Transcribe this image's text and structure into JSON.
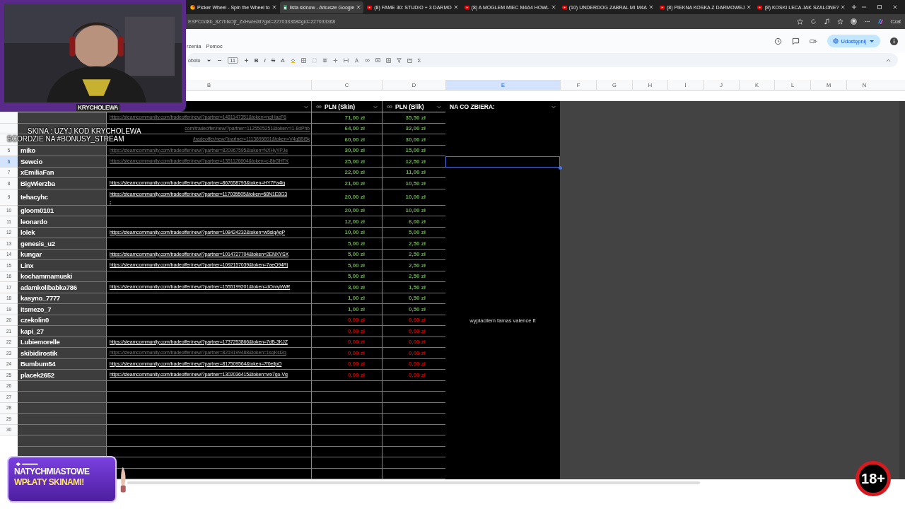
{
  "browser": {
    "tabs": [
      {
        "title": "Picker Wheel - Spin the Wheel to",
        "selected": false
      },
      {
        "title": "lista skinow - Arkusze Google",
        "selected": true
      },
      {
        "title": "(8) FAME 30: STUDIO + 3 DARMO",
        "selected": false
      },
      {
        "title": "(8) A MOGLEM MIEC M4A4 HOWL",
        "selected": false
      },
      {
        "title": "(10) UNDERDOG ZABRAL MI M4A",
        "selected": false
      },
      {
        "title": "(8) PIEKNA KOSKA Z DARMOWEJ",
        "selected": false
      },
      {
        "title": "(8) KOSKI LECA JAK SZALONE?",
        "selected": false
      }
    ],
    "address": "ESPC0d8b_8Z7hlkOjf_ZxHw/edit?gid=227033368#gid=227033368",
    "chat": "Czat"
  },
  "sheets": {
    "menu": [
      "rzenia",
      "Pomoc"
    ],
    "share_button": "Udostępnij",
    "toolbar": {
      "font": "oboto",
      "size": "11",
      "format_buttons": [
        "B",
        "I",
        "S",
        "A"
      ],
      "sum": "Σ"
    }
  },
  "column_letters": [
    {
      "label": "B",
      "selected": false
    },
    {
      "label": "C",
      "selected": false
    },
    {
      "label": "D",
      "selected": false
    },
    {
      "label": "E",
      "selected": true
    },
    {
      "label": "F",
      "selected": false
    },
    {
      "label": "G",
      "selected": false
    },
    {
      "label": "H",
      "selected": false
    },
    {
      "label": "I",
      "selected": false
    },
    {
      "label": "J",
      "selected": false
    },
    {
      "label": "K",
      "selected": false
    },
    {
      "label": "L",
      "selected": false
    },
    {
      "label": "M",
      "selected": false
    },
    {
      "label": "N",
      "selected": false
    }
  ],
  "header_row": {
    "column_c": "PLN (Skin)",
    "column_d": "PLN (Blik)",
    "column_e": "NA CO ZBIERA:"
  },
  "rows": [
    {
      "link": "https://steamcommunity.com/tradeoffer/new/?partner=1481147351&token=ncjHacF6",
      "link_dim": true,
      "skin": "71,00 zł",
      "blik": "35,50 zł",
      "color": "#6aa84f",
      "selected": false
    },
    {
      "link": "com/tradeoffer/new/?partner=1125505251&token=I1-8dPhb",
      "link_dim": true,
      "covered": true,
      "skin": "64,00 zł",
      "blik": "32,00 zł",
      "color": "#6aa84f",
      "selected": false
    },
    {
      "link": "/tradeoffer/new/?partner=1113895891&token=V4q8Bi5k",
      "link_dim": true,
      "covered": true,
      "skin": "60,00 zł",
      "blik": "30,00 zł",
      "color": "#6aa84f",
      "selected": false
    },
    {
      "number": "5",
      "name": "miko",
      "link": "https://steamcommunity.com/tradeoffer/new/?partner=820967595&token=NXHyYPJe",
      "link_dim": true,
      "skin": "30,00 zł",
      "blik": "15,00 zł",
      "color": "#6aa84f",
      "selected": false
    },
    {
      "number": "6",
      "name": "Sewcio",
      "link": "https://steamcommunity.com/tradeoffer/new/?partner=1351126604&token=c-8bGHTK",
      "link_dim": true,
      "skin": "25,00 zł",
      "blik": "12,50 zł",
      "color": "#6aa84f",
      "selected": true
    },
    {
      "number": "7",
      "name": "xEmiliaFan",
      "skin": "22,00 zł",
      "blik": "11,00 zł",
      "color": "#6aa84f",
      "selected": false
    },
    {
      "number": "8",
      "name": "BigWierzba",
      "link": "https://steamcommunity.com/tradeoffer/new/?partner=867658793&token=HY7Fa4lg",
      "link_dim": false,
      "skin": "21,00 zł",
      "blik": "10,50 zł",
      "color": "#6aa84f",
      "selected": false
    },
    {
      "number": "9",
      "name": "tehacyhc",
      "link": "https://steamcommunity.com/tradeoffer/new/?partner=117035505&token=68N1E8G3\n-",
      "link_dim": false,
      "skin": "20,00 zł",
      "blik": "10,00 zł",
      "color": "#6aa84f",
      "selected": false
    },
    {
      "number": "10",
      "name": "gloom0101",
      "skin": "20,00 zł",
      "blik": "10,00 zł",
      "color": "#6aa84f",
      "selected": false
    },
    {
      "number": "11",
      "name": "leonardo",
      "skin": "12,00 zł",
      "blik": "6,00 zł",
      "color": "#6aa84f",
      "selected": false
    },
    {
      "number": "12",
      "name": "lolek",
      "link": "https://steamcommunity.com/tradeoffer/new/?partner=108424232&token=w5slqAgP",
      "link_dim": false,
      "skin": "10,00 zł",
      "blik": "5,00 zł",
      "color": "#6aa84f",
      "selected": false
    },
    {
      "number": "13",
      "name": "genesis_u2",
      "skin": "5,00 zł",
      "blik": "2,50 zł",
      "color": "#6aa84f",
      "selected": false
    },
    {
      "number": "14",
      "name": "kungar",
      "link": "https://steamcommunity.com/tradeoffer/new/?partner=1014727704&token=2ENXYSX",
      "link_dim": false,
      "skin": "5,00 zł",
      "blik": "2,50 zł",
      "color": "#6aa84f",
      "selected": false
    },
    {
      "number": "15",
      "name": "Linx",
      "link": "https://steamcommunity.com/tradeoffer/new/?partner=1092157039&token=7aeQ94Rj",
      "link_dim": false,
      "skin": "5,00 zł",
      "blik": "2,50 zł",
      "color": "#6aa84f",
      "selected": false
    },
    {
      "number": "16",
      "name": "kochammamuski",
      "skin": "5,00 zł",
      "blik": "2,50 zł",
      "color": "#6aa84f",
      "selected": false
    },
    {
      "number": "17",
      "name": "adamkolibabka786",
      "link": "https://steamcommunity.com/tradeoffer/new/?partner=1555199201&token=dOnryhWR",
      "link_dim": false,
      "skin": "3,00 zł",
      "blik": "1,50 zł",
      "color": "#6aa84f",
      "selected": false
    },
    {
      "number": "18",
      "name": "kasyno_7777",
      "skin": "1,00 zł",
      "blik": "0,50 zł",
      "color": "#6aa84f",
      "selected": false
    },
    {
      "number": "19",
      "name": "itsmezo_7",
      "skin": "1,00 zł",
      "blik": "0,50 zł",
      "color": "#6aa84f",
      "selected": false
    },
    {
      "number": "20",
      "name": "czekolin0",
      "skin": "0,00 zł",
      "blik": "0,00 zł",
      "color": "#cc0000",
      "note": "wyplacilem famas valence ft",
      "selected": false
    },
    {
      "number": "21",
      "name": "kapi_27",
      "skin": "0,00 zł",
      "blik": "0,00 zł",
      "color": "#cc0000",
      "selected": false
    },
    {
      "number": "22",
      "name": "Lubiemorelle",
      "link": "https://steamcommunity.com/tradeoffer/new/?partner=1737253866&token=7dB-3KJZ",
      "link_dim": false,
      "skin": "0,00 zł",
      "blik": "0,00 zł",
      "color": "#cc0000",
      "selected": false
    },
    {
      "number": "23",
      "name": "skibidirostik",
      "link": "https://steamcommunity.com/tradeoffer/new/?partner=8219199488&token=1sqKsI2g",
      "link_dim": true,
      "skin": "0,00 zł",
      "blik": "0,00 zł",
      "color": "#cc0000",
      "selected": false
    },
    {
      "number": "24",
      "name": "Bumbum54",
      "link": "https://steamcommunity.com/tradeoffer/new/?partner=817509564&token=7f0eIlpO",
      "link_dim": false,
      "skin": "0,00 zł",
      "blik": "0,00 zł",
      "color": "#cc0000",
      "selected": false
    },
    {
      "number": "25",
      "name": "placek2652",
      "link": "https://steamcommunity.com/tradeoffer/new/?partner=1302036415&token=wx7go-Vg",
      "link_dim": false,
      "skin": "0,00 zł",
      "blik": "0,00 zł",
      "color": "#cc0000",
      "selected": false
    }
  ],
  "empty_rows": [
    "26",
    "27",
    "28",
    "29",
    "30"
  ],
  "overlays": {
    "webcam_label": "KRYCHOLEWA",
    "ticker_lines": [
      "SKINA : UZYJ KOD KRYCHOLEWA",
      "SCORDZIE NA #BONUSY_STREAM"
    ],
    "promo_lines": [
      "NATYCHMIASTOWE",
      "WPŁATY SKINAMI!"
    ],
    "age_badge": "18+"
  }
}
